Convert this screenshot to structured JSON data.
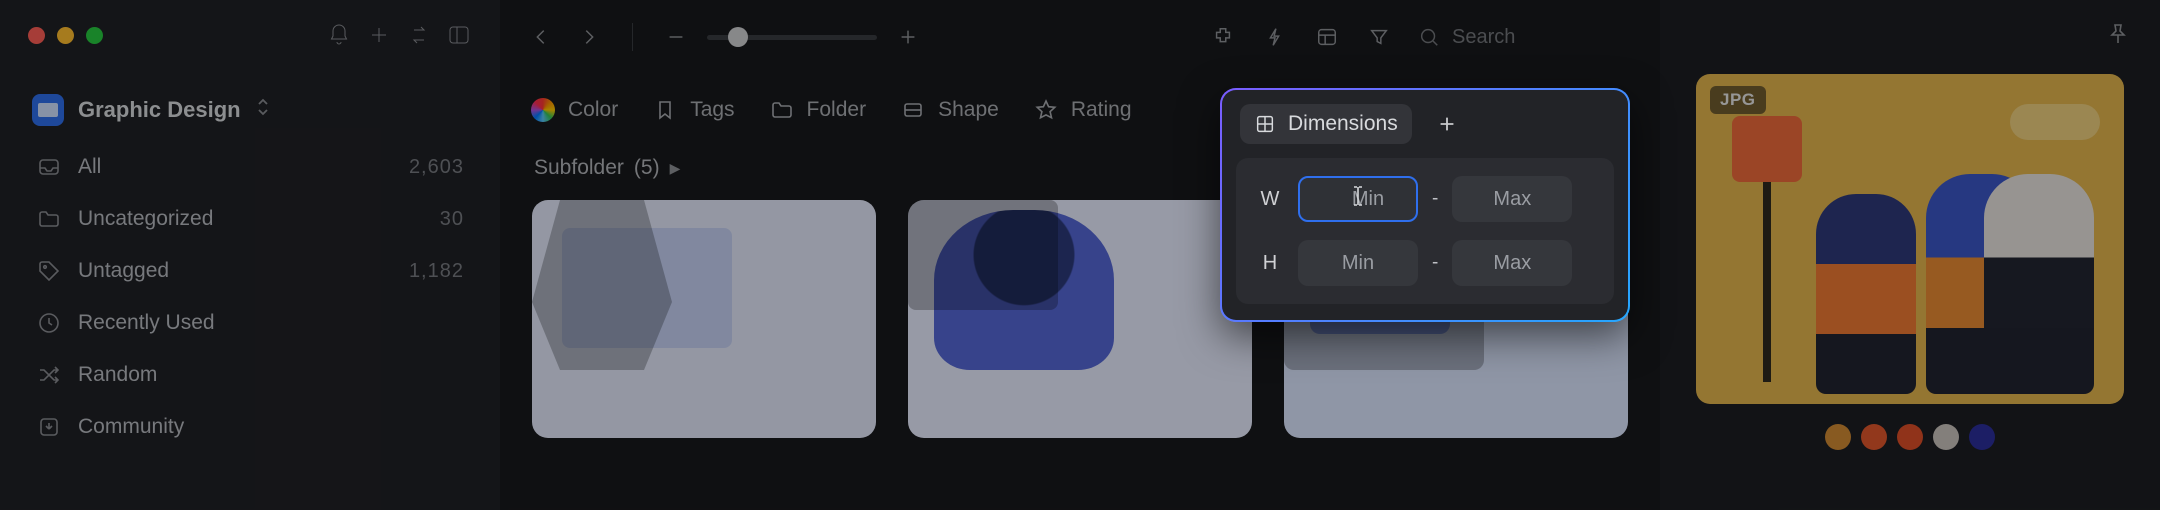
{
  "traffic": {
    "close": "#ff5f56",
    "min": "#ffbd2e",
    "max": "#27c93f"
  },
  "library": {
    "name": "Graphic Design"
  },
  "sidebar": {
    "items": [
      {
        "icon": "inbox",
        "label": "All",
        "count": "2,603"
      },
      {
        "icon": "folder-x",
        "label": "Uncategorized",
        "count": "30"
      },
      {
        "icon": "tag-x",
        "label": "Untagged",
        "count": "1,182"
      },
      {
        "icon": "clock",
        "label": "Recently Used",
        "count": ""
      },
      {
        "icon": "shuffle",
        "label": "Random",
        "count": ""
      },
      {
        "icon": "download",
        "label": "Community",
        "count": ""
      }
    ]
  },
  "search": {
    "placeholder": "Search"
  },
  "filters": [
    {
      "key": "color",
      "label": "Color"
    },
    {
      "key": "tags",
      "label": "Tags"
    },
    {
      "key": "folder",
      "label": "Folder"
    },
    {
      "key": "shape",
      "label": "Shape"
    },
    {
      "key": "rating",
      "label": "Rating"
    },
    {
      "key": "dimensions",
      "label": "Dimensions"
    }
  ],
  "subfolder": {
    "label": "Subfolder",
    "count": "5"
  },
  "popover": {
    "title": "Dimensions",
    "w_label": "W",
    "h_label": "H",
    "min_placeholder": "Min",
    "max_placeholder": "Max",
    "separator": "-"
  },
  "inspector": {
    "badge": "JPG",
    "swatches": [
      "#d18a34",
      "#e0572c",
      "#dd4f28",
      "#c9c3bd",
      "#2b2e9b"
    ]
  }
}
